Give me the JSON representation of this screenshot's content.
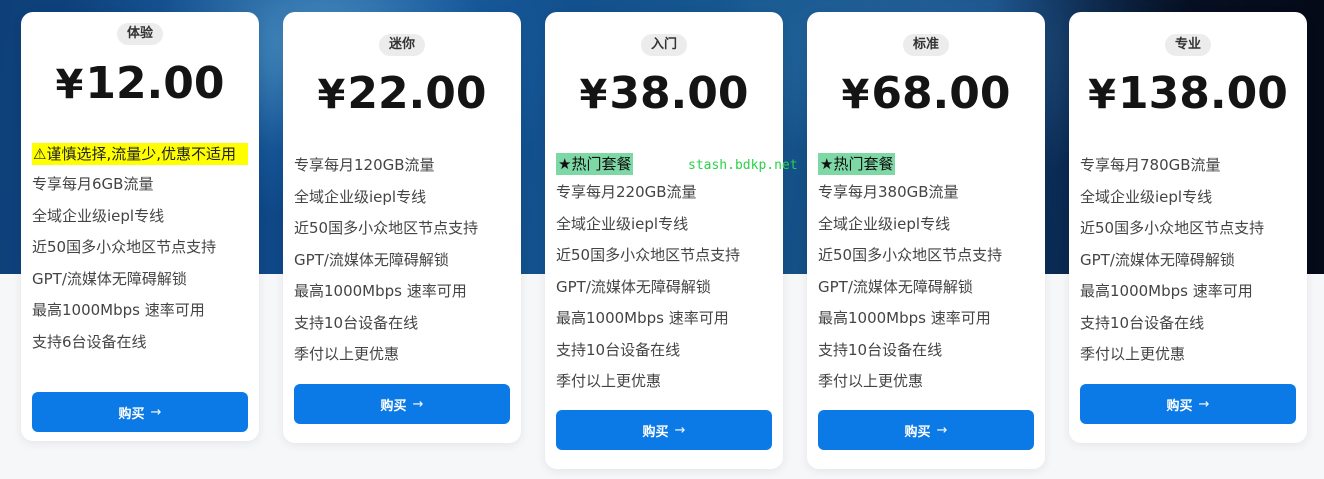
{
  "watermark": "stash.bdkp.net",
  "accent_color": "#0b7ae6",
  "buy_label": "购买",
  "arrow_icon": "→",
  "plans": [
    {
      "badge": "体验",
      "currency": "¥",
      "price": "12.00",
      "warning": "⚠谨慎选择,流量少,优惠不适用",
      "features": [
        "专享每月6GB流量",
        "全域企业级iepl专线",
        "近50国多小众地区节点支持",
        "GPT/流媒体无障碍解锁",
        "最高1000Mbps 速率可用",
        "支持6台设备在线"
      ]
    },
    {
      "badge": "迷你",
      "currency": "¥",
      "price": "22.00",
      "features": [
        "专享每月120GB流量",
        "全域企业级iepl专线",
        "近50国多小众地区节点支持",
        "GPT/流媒体无障碍解锁",
        "最高1000Mbps 速率可用",
        "支持10台设备在线",
        "季付以上更优惠"
      ]
    },
    {
      "badge": "入门",
      "currency": "¥",
      "price": "38.00",
      "hot": "★热门套餐",
      "features": [
        "专享每月220GB流量",
        "全域企业级iepl专线",
        "近50国多小众地区节点支持",
        "GPT/流媒体无障碍解锁",
        "最高1000Mbps 速率可用",
        "支持10台设备在线",
        "季付以上更优惠"
      ]
    },
    {
      "badge": "标准",
      "currency": "¥",
      "price": "68.00",
      "hot": "★热门套餐",
      "features": [
        "专享每月380GB流量",
        "全域企业级iepl专线",
        "近50国多小众地区节点支持",
        "GPT/流媒体无障碍解锁",
        "最高1000Mbps 速率可用",
        "支持10台设备在线",
        "季付以上更优惠"
      ]
    },
    {
      "badge": "专业",
      "currency": "¥",
      "price": "138.00",
      "features": [
        "专享每月780GB流量",
        "全域企业级iepl专线",
        "近50国多小众地区节点支持",
        "GPT/流媒体无障碍解锁",
        "最高1000Mbps 速率可用",
        "支持10台设备在线",
        "季付以上更优惠"
      ]
    }
  ]
}
